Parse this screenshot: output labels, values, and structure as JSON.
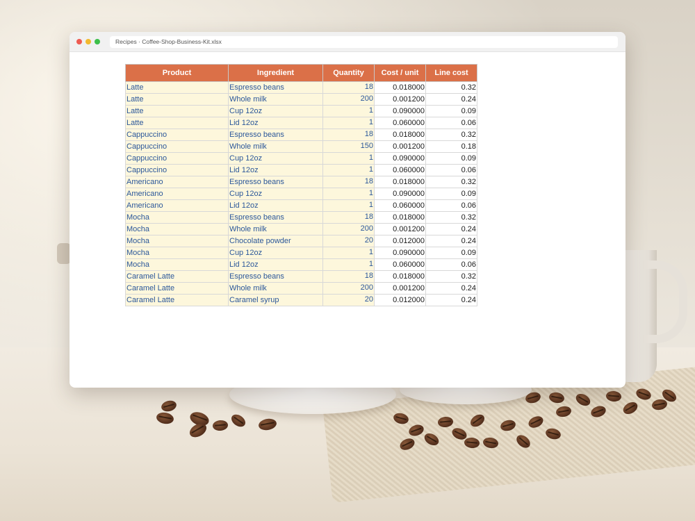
{
  "window": {
    "address": "Recipes · Coffee-Shop-Business-Kit.xlsx"
  },
  "table": {
    "headers": {
      "product": "Product",
      "ingredient": "Ingredient",
      "quantity": "Quantity",
      "cost_unit": "Cost / unit",
      "line_cost": "Line cost"
    },
    "rows": [
      {
        "product": "Latte",
        "ingredient": "Espresso beans",
        "quantity": "18",
        "cost_unit": "0.018000",
        "line_cost": "0.32"
      },
      {
        "product": "Latte",
        "ingredient": "Whole milk",
        "quantity": "200",
        "cost_unit": "0.001200",
        "line_cost": "0.24"
      },
      {
        "product": "Latte",
        "ingredient": "Cup 12oz",
        "quantity": "1",
        "cost_unit": "0.090000",
        "line_cost": "0.09"
      },
      {
        "product": "Latte",
        "ingredient": "Lid 12oz",
        "quantity": "1",
        "cost_unit": "0.060000",
        "line_cost": "0.06"
      },
      {
        "product": "Cappuccino",
        "ingredient": "Espresso beans",
        "quantity": "18",
        "cost_unit": "0.018000",
        "line_cost": "0.32"
      },
      {
        "product": "Cappuccino",
        "ingredient": "Whole milk",
        "quantity": "150",
        "cost_unit": "0.001200",
        "line_cost": "0.18"
      },
      {
        "product": "Cappuccino",
        "ingredient": "Cup 12oz",
        "quantity": "1",
        "cost_unit": "0.090000",
        "line_cost": "0.09"
      },
      {
        "product": "Cappuccino",
        "ingredient": "Lid 12oz",
        "quantity": "1",
        "cost_unit": "0.060000",
        "line_cost": "0.06"
      },
      {
        "product": "Americano",
        "ingredient": "Espresso beans",
        "quantity": "18",
        "cost_unit": "0.018000",
        "line_cost": "0.32"
      },
      {
        "product": "Americano",
        "ingredient": "Cup 12oz",
        "quantity": "1",
        "cost_unit": "0.090000",
        "line_cost": "0.09"
      },
      {
        "product": "Americano",
        "ingredient": "Lid 12oz",
        "quantity": "1",
        "cost_unit": "0.060000",
        "line_cost": "0.06"
      },
      {
        "product": "Mocha",
        "ingredient": "Espresso beans",
        "quantity": "18",
        "cost_unit": "0.018000",
        "line_cost": "0.32"
      },
      {
        "product": "Mocha",
        "ingredient": "Whole milk",
        "quantity": "200",
        "cost_unit": "0.001200",
        "line_cost": "0.24"
      },
      {
        "product": "Mocha",
        "ingredient": "Chocolate powder",
        "quantity": "20",
        "cost_unit": "0.012000",
        "line_cost": "0.24"
      },
      {
        "product": "Mocha",
        "ingredient": "Cup 12oz",
        "quantity": "1",
        "cost_unit": "0.090000",
        "line_cost": "0.09"
      },
      {
        "product": "Mocha",
        "ingredient": "Lid 12oz",
        "quantity": "1",
        "cost_unit": "0.060000",
        "line_cost": "0.06"
      },
      {
        "product": "Caramel Latte",
        "ingredient": "Espresso beans",
        "quantity": "18",
        "cost_unit": "0.018000",
        "line_cost": "0.32"
      },
      {
        "product": "Caramel Latte",
        "ingredient": "Whole milk",
        "quantity": "200",
        "cost_unit": "0.001200",
        "line_cost": "0.24"
      },
      {
        "product": "Caramel Latte",
        "ingredient": "Caramel syrup",
        "quantity": "20",
        "cost_unit": "0.012000",
        "line_cost": "0.24"
      }
    ]
  },
  "colors": {
    "header_bg": "#db7048",
    "input_cell_bg": "#fdf7dc",
    "input_text": "#2b579a"
  }
}
